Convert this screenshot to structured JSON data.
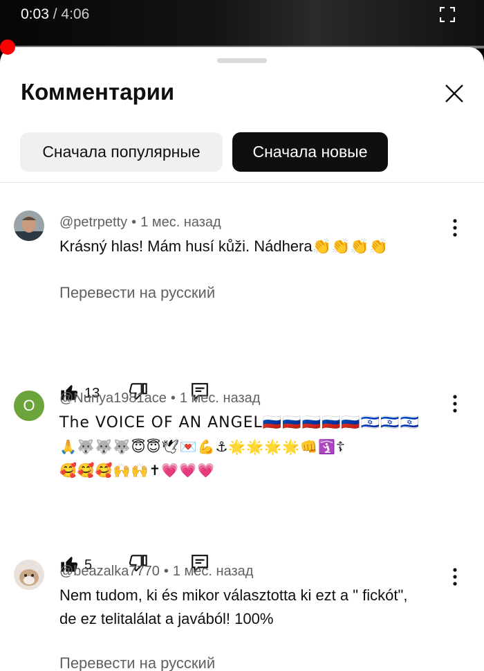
{
  "player": {
    "current_time": "0:03",
    "separator": "/",
    "duration": "4:06",
    "progress_fraction": 0.012
  },
  "sheet": {
    "title": "Комментарии",
    "sort_chips": [
      "Сначала популярные",
      "Сначала новые"
    ],
    "active_chip": "Сначала новые"
  },
  "comments": [
    {
      "author": "@petrpetty",
      "time": "1 мес. назад",
      "text": "Krásný hlas! Mám husí kůži. Nádhera👏👏👏👏",
      "translate": "Перевести на русский",
      "likes": "13"
    },
    {
      "author": "@Nunya1981ace",
      "avatar_letter": "O",
      "time": "1 мес. назад",
      "text_line1": "The VOICE OF AN ANGEL🇷🇺🇷🇺🇷🇺🇷🇺🇷🇺🇮🇱🇮🇱🇮🇱",
      "text_line2": "🙏🐺🐺🐺😇😇🕊💌💪⚓🌟🌟🌟🌟👊🛐☦",
      "text_line3": "🥰🥰🥰🙌🙌✝💗💗💗",
      "likes": "5"
    },
    {
      "author": "@beazalka7770",
      "time": "1 мес. назад",
      "text": "Nem tudom, ki és mikor választotta ki ezt a \" fickót\", de ez telitalálat a javából! 100%",
      "translate": "Перевести на русский"
    }
  ],
  "colors": {
    "accent_red": "#ff0000",
    "avatar_green": "#6ba43a",
    "dark_chip": "#0f0f0f",
    "light_chip": "#f0f0f0"
  }
}
